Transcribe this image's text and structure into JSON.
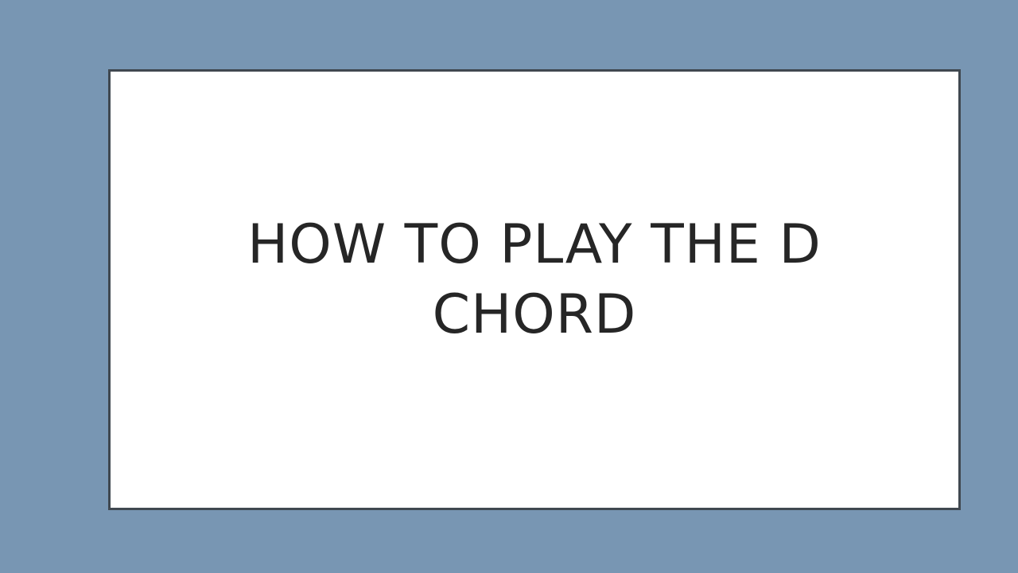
{
  "slide": {
    "title_lines": [
      "HOW TO PLAY THE D",
      "CHORD"
    ]
  },
  "colors": {
    "background": "#7896b3",
    "frame_border": "#404850",
    "frame_fill": "#ffffff",
    "title_text": "#262626"
  }
}
